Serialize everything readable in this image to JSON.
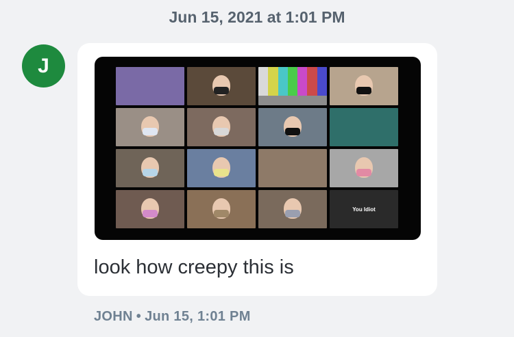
{
  "thread": {
    "timestamp": "Jun 15, 2021 at 1:01 PM"
  },
  "message": {
    "sender_initial": "J",
    "avatar_color": "#1e8a3e",
    "text": "look how creepy this is",
    "meta_sender": "JOHN",
    "meta_separator": "•",
    "meta_time": "Jun 15, 1:01 PM"
  },
  "attachment": {
    "tiles": [
      {
        "bg": "#7a6aa6",
        "name": "",
        "face": false
      },
      {
        "bg": "#5b4a3a",
        "name": "",
        "face": true,
        "mask": "#222"
      },
      {
        "bg": "#8c8c8c",
        "name": "",
        "face": false,
        "bars": true
      },
      {
        "bg": "#b7a48e",
        "name": "",
        "face": true,
        "mask": "#111"
      },
      {
        "bg": "#9a8f86",
        "name": "",
        "face": true,
        "mask": "#dfe6f2"
      },
      {
        "bg": "#7d6a5f",
        "name": "",
        "face": true,
        "mask": "#d8d8d8"
      },
      {
        "bg": "#6d7b88",
        "name": "",
        "face": true,
        "mask": "#101010"
      },
      {
        "bg": "#2f6f6a",
        "name": "",
        "face": false
      },
      {
        "bg": "#6f6458",
        "name": "",
        "face": true,
        "mask": "#b6d5e8"
      },
      {
        "bg": "#6a7fa0",
        "name": "",
        "face": true,
        "mask": "#e9e38c"
      },
      {
        "bg": "#8e7a68",
        "name": "",
        "face": false
      },
      {
        "bg": "#a7a7a7",
        "name": "",
        "face": true,
        "mask": "#e28aa4"
      },
      {
        "bg": "#6f5b51",
        "name": "",
        "face": true,
        "mask": "#d38bc9"
      },
      {
        "bg": "#8a7057",
        "name": "",
        "face": true,
        "mask": "#a08868"
      },
      {
        "bg": "#7a6a5c",
        "name": "",
        "face": true,
        "mask": "#9a9fb0"
      },
      {
        "bg": "#2a2a2a",
        "name": "",
        "face": false,
        "label": "You Idiot"
      }
    ]
  }
}
